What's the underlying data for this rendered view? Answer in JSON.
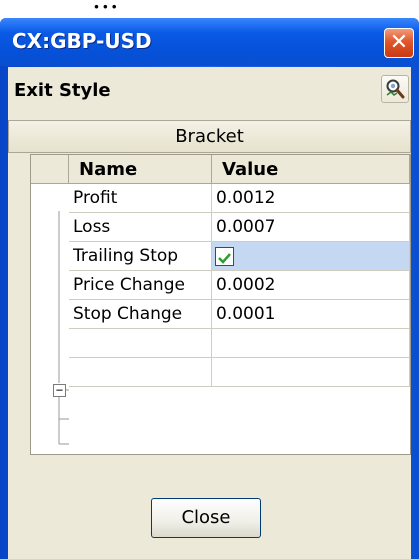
{
  "caption_top": "...",
  "window": {
    "title": "CX:GBP-USD",
    "close_glyph": "✕"
  },
  "section": {
    "title": "Exit Style",
    "detect_icon": "magnifier-icon"
  },
  "bracket_label": "Bracket",
  "grid": {
    "columns": [
      "Name",
      "Value"
    ],
    "rows": [
      {
        "name": "Profit",
        "value": "0.0012"
      },
      {
        "name": "Loss",
        "value": "0.0007"
      },
      {
        "name": "Trailing Stop",
        "value": "",
        "checked": true,
        "selected": true
      },
      {
        "name": "Price Change",
        "value": "0.0002"
      },
      {
        "name": "Stop Change",
        "value": "0.0001"
      }
    ],
    "collapse_glyph": "−"
  },
  "close_label": "Close",
  "colors": {
    "titlebar": "#0a4fd0",
    "client": "#ece9d8",
    "selection": "#c4d8f2",
    "check": "#2f9e2f"
  }
}
